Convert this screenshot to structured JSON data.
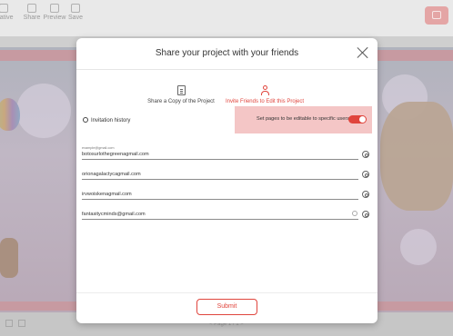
{
  "toolbar": {
    "decorative_label": "orative",
    "share_label": "Share",
    "preview_label": "Preview",
    "save_label": "Save"
  },
  "footer": {
    "page_indicator": "< Page 1 / 1 >"
  },
  "modal": {
    "title": "Share your project with your friends",
    "tabs": [
      {
        "label": "Share a Copy of the Project",
        "icon": "document-icon",
        "active": false
      },
      {
        "label": "Invite Friends to Edit this Project",
        "icon": "person-icon",
        "active": true
      }
    ],
    "history_label": "Invitation history",
    "editable_label": "Set pages to be editable to specific users",
    "editable_on": true,
    "emails": [
      {
        "label": "example@gmail.com",
        "value": "botosurlothegreenagmail.com"
      },
      {
        "label": "",
        "value": "orionagalactycagmail.com"
      },
      {
        "label": "",
        "value": "irvwoiskenagmail.com"
      },
      {
        "label": "",
        "value": "fantasitycminds@gmail.com"
      }
    ],
    "submit_label": "Submit"
  },
  "colors": {
    "accent": "#e0453d",
    "panel": "#f4c6c6"
  }
}
